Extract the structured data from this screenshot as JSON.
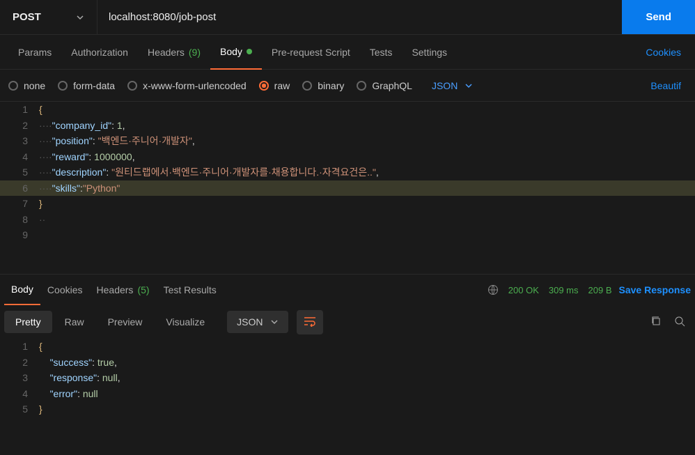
{
  "request": {
    "method": "POST",
    "url": "localhost:8080/job-post",
    "sendLabel": "Send"
  },
  "tabs": {
    "params": "Params",
    "auth": "Authorization",
    "headers": "Headers",
    "headersCount": "(9)",
    "body": "Body",
    "prereq": "Pre-request Script",
    "tests": "Tests",
    "settings": "Settings",
    "cookies": "Cookies"
  },
  "bodyOpts": {
    "none": "none",
    "formData": "form-data",
    "xform": "x-www-form-urlencoded",
    "raw": "raw",
    "binary": "binary",
    "graphql": "GraphQL",
    "typeLabel": "JSON",
    "beautify": "Beautif"
  },
  "reqBody": {
    "k1": "\"company_id\"",
    "v1": "1",
    "k2": "\"position\"",
    "v2": "\"백엔드·주니어·개발자\"",
    "k3": "\"reward\"",
    "v3": "1000000",
    "k4": "\"description\"",
    "v4": "\"원티드랩에서·백엔드·주니어·개발자를·채용합니다.·자격요건은..\"",
    "k5": "\"skills\"",
    "v5": "\"Python\""
  },
  "respTabs": {
    "body": "Body",
    "cookies": "Cookies",
    "headers": "Headers",
    "headersCount": "(5)",
    "testResults": "Test Results"
  },
  "respStatus": {
    "code": "200 OK",
    "time": "309 ms",
    "size": "209 B",
    "save": "Save Response"
  },
  "viewOpts": {
    "pretty": "Pretty",
    "raw": "Raw",
    "preview": "Preview",
    "visualize": "Visualize",
    "fmt": "JSON"
  },
  "respBody": {
    "k1": "\"success\"",
    "v1": "true",
    "k2": "\"response\"",
    "v2": "null",
    "k3": "\"error\"",
    "v3": "null"
  }
}
